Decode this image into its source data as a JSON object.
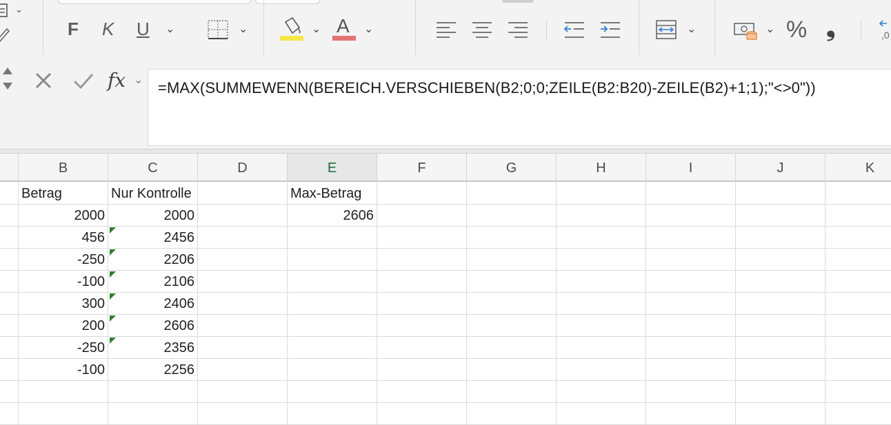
{
  "ribbon": {
    "bold_label": "F",
    "italic_label": "K",
    "underline_label": "U",
    "font_color_label": "A",
    "percent_label": "%",
    "thousands_label": "❟",
    "fill_color": "#f7e64a",
    "font_color": "#e57373"
  },
  "formula_bar": {
    "fx_label": "fx",
    "formula": "=MAX(SUMMEWENN(BEREICH.VERSCHIEBEN(B2;0;0;ZEILE(B2:B20)-ZEILE(B2)+1;1);\"<>0\"))"
  },
  "columns": [
    "B",
    "C",
    "D",
    "E",
    "F",
    "G",
    "H",
    "I",
    "J",
    "K"
  ],
  "active_column": "E",
  "rows": [
    [
      "Betrag",
      "Nur Kontrolle",
      "",
      "Max-Betrag",
      "",
      "",
      "",
      "",
      "",
      ""
    ],
    [
      "2000",
      "2000",
      "",
      "2606",
      "",
      "",
      "",
      "",
      "",
      ""
    ],
    [
      "456",
      "2456",
      "",
      "",
      "",
      "",
      "",
      "",
      "",
      ""
    ],
    [
      "-250",
      "2206",
      "",
      "",
      "",
      "",
      "",
      "",
      "",
      ""
    ],
    [
      "-100",
      "2106",
      "",
      "",
      "",
      "",
      "",
      "",
      "",
      ""
    ],
    [
      "300",
      "2406",
      "",
      "",
      "",
      "",
      "",
      "",
      "",
      ""
    ],
    [
      "200",
      "2606",
      "",
      "",
      "",
      "",
      "",
      "",
      "",
      ""
    ],
    [
      "-250",
      "2356",
      "",
      "",
      "",
      "",
      "",
      "",
      "",
      ""
    ],
    [
      "-100",
      "2256",
      "",
      "",
      "",
      "",
      "",
      "",
      "",
      ""
    ],
    [
      "",
      "",
      "",
      "",
      "",
      "",
      "",
      "",
      "",
      ""
    ],
    [
      "",
      "",
      "",
      "",
      "",
      "",
      "",
      "",
      "",
      ""
    ]
  ],
  "error_indicator_cells": [
    [
      2,
      1
    ],
    [
      3,
      1
    ],
    [
      4,
      1
    ],
    [
      5,
      1
    ],
    [
      6,
      1
    ],
    [
      7,
      1
    ]
  ]
}
